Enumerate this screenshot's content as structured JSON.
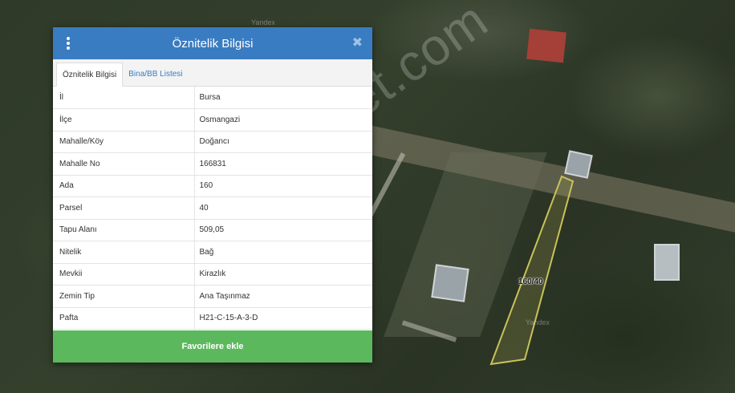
{
  "panel": {
    "title": "Öznitelik Bilgisi",
    "menu_icon": "vertical-dots-icon",
    "close_label": "✖",
    "tabs": [
      {
        "label": "Öznitelik Bilgisi",
        "active": true
      },
      {
        "label": "Bina/BB Listesi",
        "active": false
      }
    ],
    "rows": [
      {
        "key": "İl",
        "value": "Bursa"
      },
      {
        "key": "İlçe",
        "value": "Osmangazi"
      },
      {
        "key": "Mahalle/Köy",
        "value": "Doğancı"
      },
      {
        "key": "Mahalle No",
        "value": "166831"
      },
      {
        "key": "Ada",
        "value": "160"
      },
      {
        "key": "Parsel",
        "value": "40"
      },
      {
        "key": "Tapu Alanı",
        "value": "509,05"
      },
      {
        "key": "Nitelik",
        "value": "Bağ"
      },
      {
        "key": "Mevkii",
        "value": "Kirazlık"
      },
      {
        "key": "Zemin Tip",
        "value": "Ana Taşınmaz"
      },
      {
        "key": "Pafta",
        "value": "H21-C-15-A-3-D"
      }
    ],
    "favorite_button": "Favorilere ekle"
  },
  "map": {
    "watermark": "emlakjet.com",
    "parcel_label": "160/40",
    "attribution": "Yandex",
    "attribution_top": "Yandex",
    "parcel_outline_color": "#c9c25a"
  },
  "colors": {
    "header": "#3a7cc1",
    "button": "#5cb85c"
  }
}
